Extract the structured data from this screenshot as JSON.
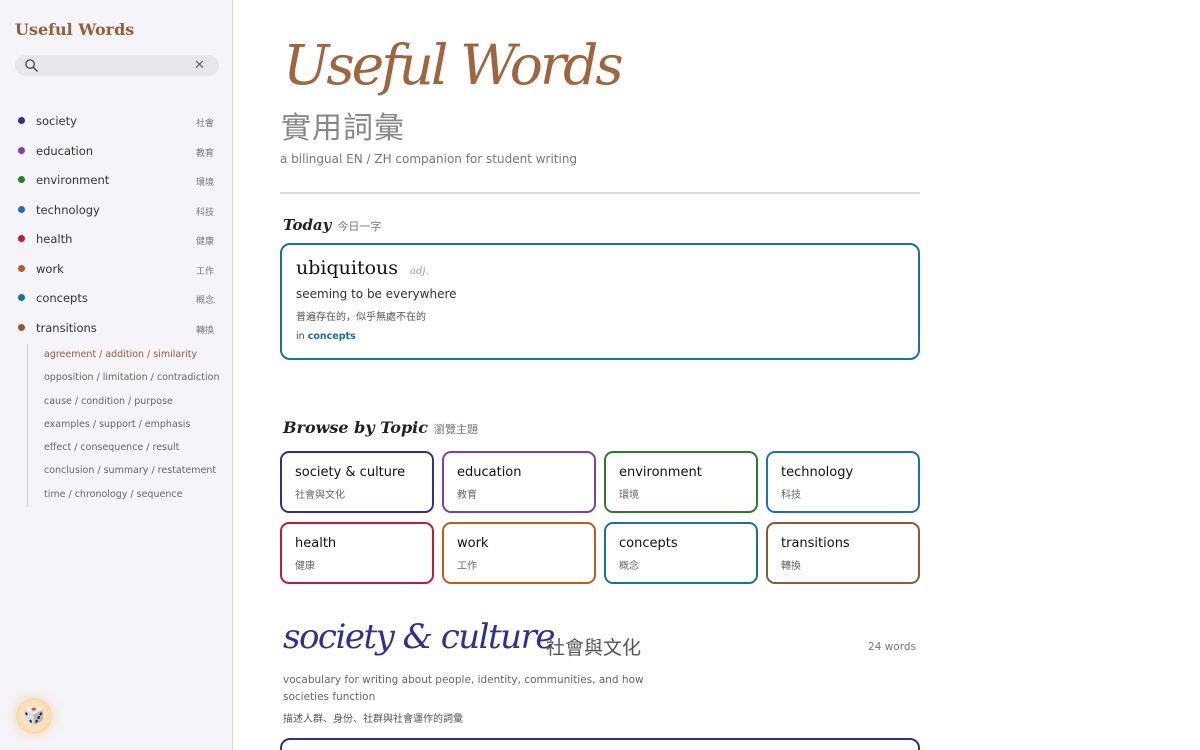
{
  "sidebar": {
    "brand": "Useful Words",
    "search": {
      "placeholder": "",
      "value": ""
    },
    "topics": [
      {
        "label": "society",
        "zh": "社會",
        "color": "#2f2f9a"
      },
      {
        "label": "education",
        "zh": "教育",
        "color": "#7a3fb0"
      },
      {
        "label": "environment",
        "zh": "環境",
        "color": "#2d7a2d"
      },
      {
        "label": "technology",
        "zh": "科技",
        "color": "#1d6fc0"
      },
      {
        "label": "health",
        "zh": "健康",
        "color": "#c0193a"
      },
      {
        "label": "work",
        "zh": "工作",
        "color": "#c25a1c"
      },
      {
        "label": "concepts",
        "zh": "概念",
        "color": "#1f6f9b"
      },
      {
        "label": "transitions",
        "zh": "轉換",
        "color": "#8b5a3c"
      }
    ],
    "transitions_sub": [
      "agreement / addition / similarity",
      "opposition / limitation / contradiction",
      "cause / condition / purpose",
      "examples / support / emphasis",
      "effect / consequence / result",
      "conclusion / summary / restatement",
      "time / chronology / sequence"
    ],
    "random_icon": "dice-icon"
  },
  "hero": {
    "title": "Useful Words",
    "title_zh": "實用詞彙",
    "subtitle": "a bilingual EN / ZH companion for student writing"
  },
  "today": {
    "heading": "Today",
    "heading_zh": "今日一字",
    "word": "ubiquitous",
    "pos": "adj.",
    "definition": "seeming to be everywhere",
    "definition_zh": "普遍存在的，似乎無處不在的",
    "in_prefix": "in",
    "topic": "concepts"
  },
  "browse": {
    "heading": "Browse by Topic",
    "heading_zh": "瀏覽主題",
    "topics": [
      {
        "label": "society & culture",
        "zh": "社會與文化",
        "color": "#2f2f9a"
      },
      {
        "label": "education",
        "zh": "教育",
        "color": "#7a3fb0"
      },
      {
        "label": "environment",
        "zh": "環境",
        "color": "#2d7a2d"
      },
      {
        "label": "technology",
        "zh": "科技",
        "color": "#1d6fc0"
      },
      {
        "label": "health",
        "zh": "健康",
        "color": "#c0193a"
      },
      {
        "label": "work",
        "zh": "工作",
        "color": "#c25a1c"
      },
      {
        "label": "concepts",
        "zh": "概念",
        "color": "#1f6f9b"
      },
      {
        "label": "transitions",
        "zh": "轉換",
        "color": "#8b5a3c"
      }
    ]
  },
  "section": {
    "title": "society & culture",
    "title_zh": "社會與文化",
    "count": "24 words",
    "description": "vocabulary for writing about people, identity, communities, and how societies function",
    "description_zh": "描述人群、身份、社群與社會運作的詞彙"
  }
}
